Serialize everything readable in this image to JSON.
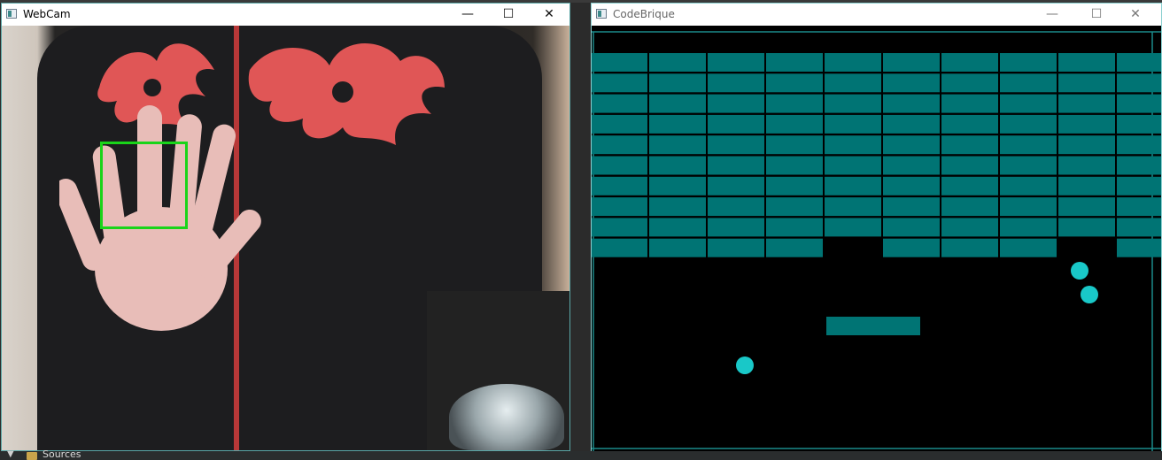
{
  "windows": {
    "webcam": {
      "title": "WebCam",
      "controls": {
        "minimize": "—",
        "maximize": "☐",
        "close": "✕"
      }
    },
    "game": {
      "title": "CodeBrique",
      "controls": {
        "minimize": "—",
        "maximize": "☐",
        "close": "✕"
      }
    }
  },
  "game": {
    "colors": {
      "brick": "#007474",
      "paddle": "#007474",
      "ball": "#19c8c8",
      "background": "#000000",
      "frame": "#1a8a8a"
    },
    "brick_grid": {
      "rows": 10,
      "columns": 10,
      "missing_in_last_row": [
        4,
        8
      ]
    },
    "balls_count": 3
  },
  "taskbar": {
    "sources_label": "Sources"
  }
}
